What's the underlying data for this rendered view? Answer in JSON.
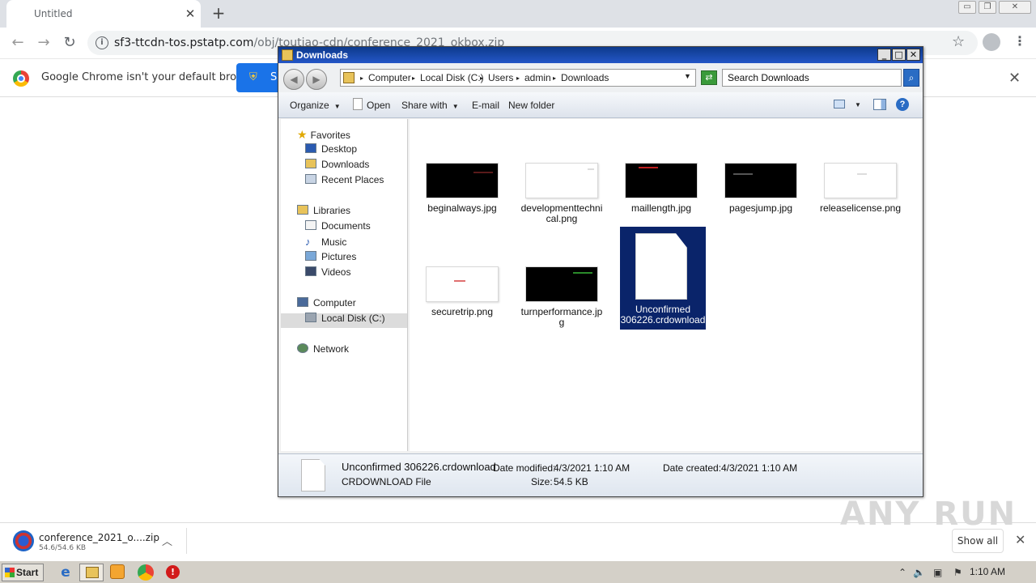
{
  "browser": {
    "tab_title": "Untitled",
    "url_host": "sf3-ttcdn-tos.pstatp.com",
    "url_path": "/obj/toutiao-cdn/conference_2021_okbox.zip",
    "infobar_text": "Google Chrome isn't your default browser",
    "set_default_label": "S"
  },
  "download": {
    "name": "conference_2021_o....zip",
    "size": "54.6/54.6 KB",
    "show_all": "Show all"
  },
  "explorer": {
    "title": "Downloads",
    "breadcrumb": [
      "Computer",
      "Local Disk (C:)",
      "Users",
      "admin",
      "Downloads"
    ],
    "search_placeholder": "Search Downloads",
    "commands": {
      "organize": "Organize",
      "open": "Open",
      "share": "Share with",
      "email": "E-mail",
      "new_folder": "New folder"
    },
    "nav": {
      "favorites": "Favorites",
      "desktop": "Desktop",
      "downloads": "Downloads",
      "recent": "Recent Places",
      "libraries": "Libraries",
      "documents": "Documents",
      "music": "Music",
      "pictures": "Pictures",
      "videos": "Videos",
      "computer": "Computer",
      "local_disk": "Local Disk (C:)",
      "network": "Network"
    },
    "files": [
      {
        "name": "beginalways.jpg",
        "thumb": "dark",
        "accent": "#5a1a1a"
      },
      {
        "name": "developmenttechnical.png",
        "thumb": "light",
        "accent": "#dddddd"
      },
      {
        "name": "maillength.jpg",
        "thumb": "dark",
        "accent": "#c02020"
      },
      {
        "name": "pagesjump.jpg",
        "thumb": "dark",
        "accent": "#555555"
      },
      {
        "name": "releaselicense.png",
        "thumb": "light",
        "accent": "#dddddd"
      },
      {
        "name": "securetrip.png",
        "thumb": "light",
        "accent": "#e07070"
      },
      {
        "name": "turnperformance.jpg",
        "thumb": "dark",
        "accent": "#2a8a2a"
      }
    ],
    "selected_file": "Unconfirmed 306226.crdownload",
    "details": {
      "name": "Unconfirmed 306226.crdownload",
      "type": "CRDOWNLOAD File",
      "modified_label": "Date modified:",
      "modified": "4/3/2021 1:10 AM",
      "created_label": "Date created:",
      "created": "4/3/2021 1:10 AM",
      "size_label": "Size:",
      "size": "54.5 KB"
    }
  },
  "taskbar": {
    "start": "Start",
    "clock": "1:10 AM"
  },
  "watermark": "ANY RUN"
}
